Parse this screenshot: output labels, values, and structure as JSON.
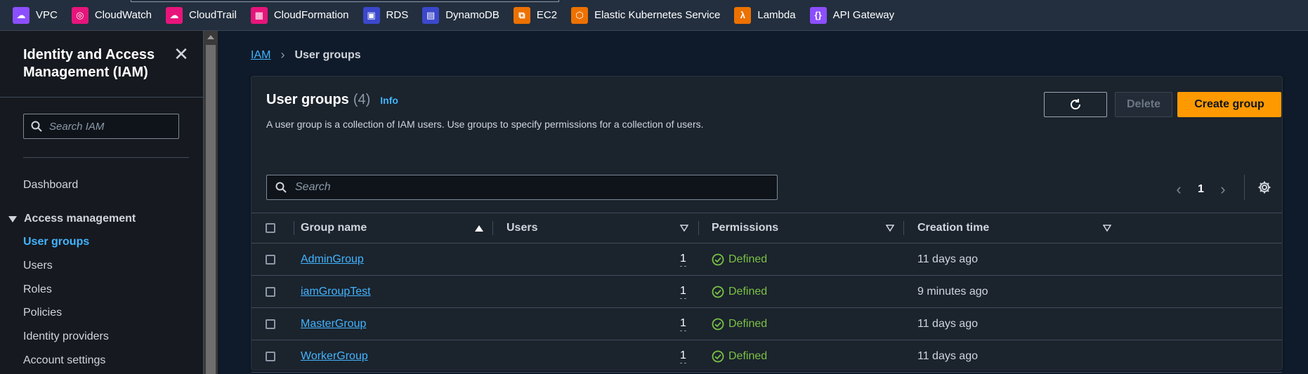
{
  "favorites": [
    {
      "label": "VPC",
      "icon": "vpc-icon",
      "color": "#8c4fff"
    },
    {
      "label": "CloudWatch",
      "icon": "cloudwatch-icon",
      "color": "#e7157b"
    },
    {
      "label": "CloudTrail",
      "icon": "cloudtrail-icon",
      "color": "#e7157b"
    },
    {
      "label": "CloudFormation",
      "icon": "cloudformation-icon",
      "color": "#e7157b"
    },
    {
      "label": "RDS",
      "icon": "rds-icon",
      "color": "#3b48cc"
    },
    {
      "label": "DynamoDB",
      "icon": "dynamodb-icon",
      "color": "#3b48cc"
    },
    {
      "label": "EC2",
      "icon": "ec2-icon",
      "color": "#ed7100"
    },
    {
      "label": "Elastic Kubernetes Service",
      "icon": "eks-icon",
      "color": "#ed7100"
    },
    {
      "label": "Lambda",
      "icon": "lambda-icon",
      "color": "#ed7100"
    },
    {
      "label": "API Gateway",
      "icon": "api-gateway-icon",
      "color": "#8c4fff"
    }
  ],
  "sidebar": {
    "title": "Identity and Access Management (IAM)",
    "search_placeholder": "Search IAM",
    "dashboard": "Dashboard",
    "section": "Access management",
    "items": [
      {
        "label": "User groups",
        "active": true
      },
      {
        "label": "Users"
      },
      {
        "label": "Roles"
      },
      {
        "label": "Policies"
      },
      {
        "label": "Identity providers"
      },
      {
        "label": "Account settings"
      }
    ]
  },
  "breadcrumb": {
    "root": "IAM",
    "current": "User groups"
  },
  "panel": {
    "title": "User groups",
    "count": "(4)",
    "info": "Info",
    "description": "A user group is a collection of IAM users. Use groups to specify permissions for a collection of users.",
    "delete_label": "Delete",
    "create_label": "Create group",
    "search_placeholder": "Search",
    "page": "1"
  },
  "table": {
    "headers": {
      "name": "Group name",
      "users": "Users",
      "permissions": "Permissions",
      "created": "Creation time"
    },
    "rows": [
      {
        "name": "AdminGroup",
        "users": "1",
        "permissions": "Defined",
        "created": "11 days ago"
      },
      {
        "name": "iamGroupTest",
        "users": "1",
        "permissions": "Defined",
        "created": "9 minutes ago"
      },
      {
        "name": "MasterGroup",
        "users": "1",
        "permissions": "Defined",
        "created": "11 days ago"
      },
      {
        "name": "WorkerGroup",
        "users": "1",
        "permissions": "Defined",
        "created": "11 days ago"
      }
    ]
  },
  "colors": {
    "accent": "#ff9900",
    "link": "#42b4ff",
    "success": "#7ac143"
  }
}
